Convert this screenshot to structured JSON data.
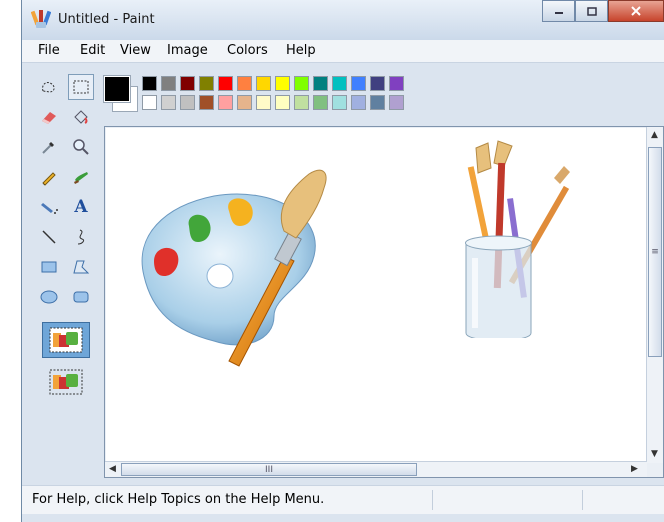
{
  "window": {
    "title": "Untitled - Paint"
  },
  "menu": {
    "items": [
      "File",
      "Edit",
      "View",
      "Image",
      "Colors",
      "Help"
    ]
  },
  "palette": {
    "foreground": "#000000",
    "background": "#ffffff",
    "row1": [
      "#000000",
      "#808080",
      "#800000",
      "#808000",
      "#ff0000",
      "#ff8040",
      "#ffd700",
      "#ffff00",
      "#80ff00",
      "#008080",
      "#00c0c0",
      "#4080ff",
      "#404080",
      "#8040c0"
    ],
    "row2": [
      "#ffffff",
      "#d0d0d0",
      "#c0c0c0",
      "#a05028",
      "#ffa0a0",
      "#e6b48c",
      "#fffac8",
      "#ffffc0",
      "#c0e0a0",
      "#80c080",
      "#a0e0e0",
      "#a0b0e0",
      "#6080a0",
      "#b0a0d0"
    ]
  },
  "tools": [
    "free-select",
    "rect-select",
    "eraser",
    "fill",
    "color-picker",
    "magnifier",
    "pencil",
    "brush",
    "airbrush",
    "text",
    "line",
    "curve",
    "rectangle",
    "polygon",
    "ellipse",
    "rounded-rectangle"
  ],
  "status": {
    "text": "For Help, click Help Topics on the Help Menu."
  }
}
